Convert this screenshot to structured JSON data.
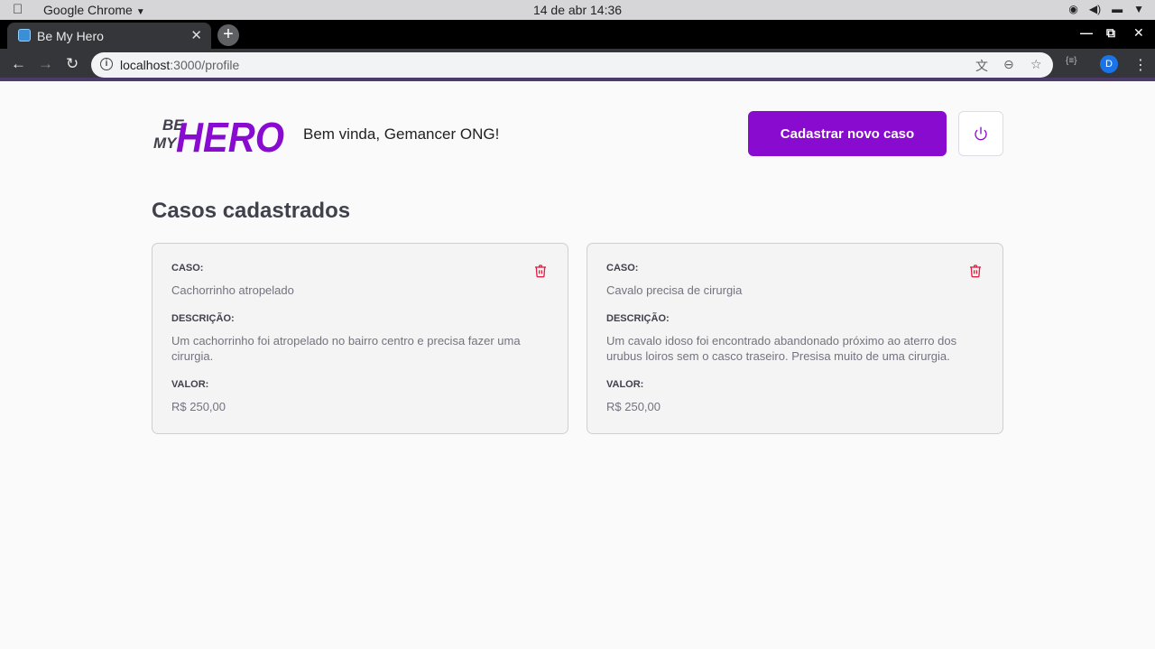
{
  "os": {
    "app_name": "Google Chrome",
    "clock": "14 de abr  14:36"
  },
  "browser": {
    "tab_title": "Be My Hero",
    "url_host": "localhost",
    "url_path": ":3000/profile",
    "profile_initial": "D"
  },
  "header": {
    "logo_line1": "BE",
    "logo_line2": "MY",
    "logo_word": "HERO",
    "welcome": "Bem vinda, Gemancer ONG!",
    "new_case_button": "Cadastrar novo caso"
  },
  "main": {
    "title": "Casos cadastrados",
    "labels": {
      "case": "CASO:",
      "description": "DESCRIÇÃO:",
      "value": "VALOR:"
    },
    "cases": [
      {
        "title": "Cachorrinho atropelado",
        "description": "Um cachorrinho foi atropelado no bairro centro e precisa fazer uma cirurgia.",
        "value": "R$ 250,00"
      },
      {
        "title": "Cavalo precisa de cirurgia",
        "description": "Um cavalo idoso foi encontrado abandonado próximo ao aterro dos urubus loiros sem o casco traseiro. Presisa muito de uma cirurgia.",
        "value": "R$ 250,00"
      }
    ]
  },
  "colors": {
    "brand": "#8a0bd0",
    "danger": "#e02041",
    "title": "#41414d",
    "muted": "#737380"
  }
}
